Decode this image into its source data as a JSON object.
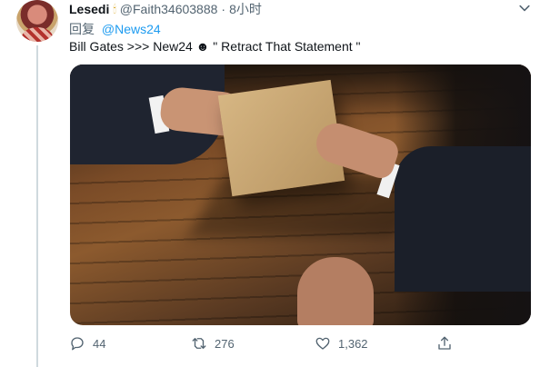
{
  "tweet": {
    "display_name": "Lesedi",
    "badge": "🕯",
    "handle": "@Faith34603888",
    "separator": "·",
    "time": "8小时",
    "reply_prefix": "回复",
    "reply_to": "@News24",
    "text": "Bill Gates >>> New24 ☻ \" Retract That Statement \"",
    "more_icon": "chevron-down-icon",
    "media_description_icon": "photo"
  },
  "actions": {
    "reply_count": "44",
    "retweet_count": "276",
    "like_count": "1,362"
  },
  "colors": {
    "link": "#1d9bf0",
    "secondary_text": "#536471",
    "primary_text": "#0f1419"
  }
}
